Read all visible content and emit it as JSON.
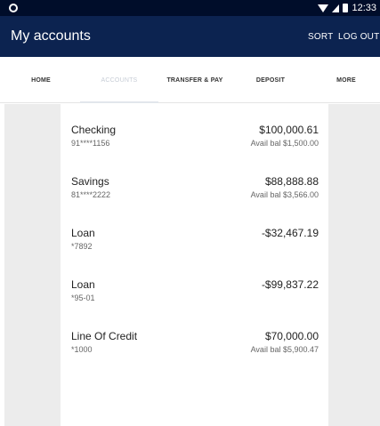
{
  "status_bar": {
    "time": "12:33"
  },
  "app_bar": {
    "title": "My accounts",
    "sort_label": "SORT",
    "logout_label": "LOG OUT"
  },
  "tabs": [
    {
      "label": "HOME",
      "active": false
    },
    {
      "label": "ACCOUNTS",
      "active": true
    },
    {
      "label": "TRANSFER & PAY",
      "active": false
    },
    {
      "label": "DEPOSIT",
      "active": false
    },
    {
      "label": "MORE",
      "active": false
    }
  ],
  "accounts": [
    {
      "name": "Checking",
      "number": "91****1156",
      "balance": "$100,000.61",
      "available": "Avail bal $1,500.00"
    },
    {
      "name": "Savings",
      "number": "81****2222",
      "balance": "$88,888.88",
      "available": "Avail bal $3,566.00"
    },
    {
      "name": "Loan",
      "number": "*7892",
      "balance": "-$32,467.19",
      "available": ""
    },
    {
      "name": "Loan",
      "number": "*95-01",
      "balance": "-$99,837.22",
      "available": ""
    },
    {
      "name": "Line Of Credit",
      "number": "*1000",
      "balance": "$70,000.00",
      "available": "Avail bal $5,900.47"
    }
  ],
  "colors": {
    "status_bar": "#000d2a",
    "app_bar": "#0c2350",
    "side_panel": "#ececec"
  }
}
